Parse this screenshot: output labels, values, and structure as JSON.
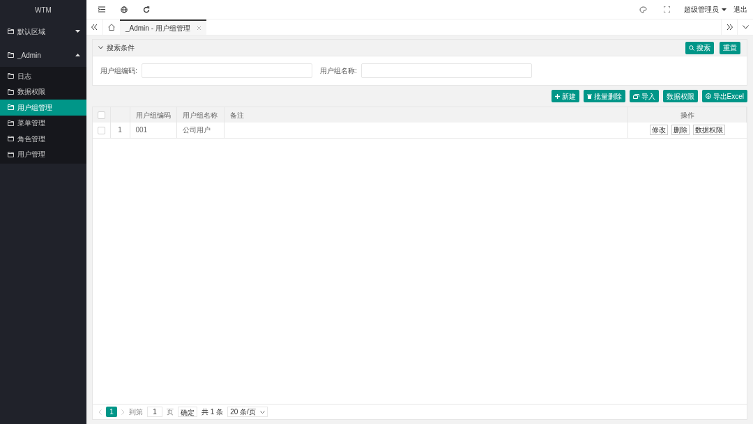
{
  "sidebar": {
    "title": "WTM",
    "groups": [
      {
        "label": "默认区域",
        "expanded": false
      },
      {
        "label": "_Admin",
        "expanded": true,
        "children": [
          {
            "label": "日志",
            "selected": false
          },
          {
            "label": "数据权限",
            "selected": false
          },
          {
            "label": "用户组管理",
            "selected": true
          },
          {
            "label": "菜单管理",
            "selected": false
          },
          {
            "label": "角色管理",
            "selected": false
          },
          {
            "label": "用户管理",
            "selected": false
          }
        ]
      }
    ]
  },
  "header": {
    "user": "超级管理员",
    "logout": "退出"
  },
  "tabs": [
    {
      "label": "_Admin - 用户组管理",
      "selected": true
    }
  ],
  "search": {
    "title": "搜索条件",
    "expanded": true,
    "buttons": [
      {
        "kind": "search",
        "label": "搜索"
      },
      {
        "kind": "plain",
        "label": "重置"
      }
    ],
    "fields": [
      {
        "label": "用户组编码:"
      },
      {
        "label": "用户组名称:"
      }
    ]
  },
  "toolbar": [
    {
      "kind": "add",
      "label": "新建"
    },
    {
      "kind": "delete",
      "label": "批量删除"
    },
    {
      "kind": "import",
      "label": "导入"
    },
    {
      "kind": "plain",
      "label": "数据权限"
    },
    {
      "kind": "export",
      "label": "导出Excel"
    }
  ],
  "table": {
    "all_checked": false,
    "columns": [
      "用户组编码",
      "用户组名称",
      "备注",
      "操作"
    ],
    "rows": [
      {
        "checked": false,
        "index": "1",
        "cells": [
          "001",
          "公司用户",
          ""
        ],
        "actions": [
          "修改",
          "删除",
          "数据权限"
        ]
      }
    ]
  },
  "pager": {
    "page": "1",
    "goto_label": "到第",
    "goto_value": "1",
    "page_unit": "页",
    "confirm": "确定",
    "total": "共 1 条",
    "page_size": "20 条/页"
  }
}
